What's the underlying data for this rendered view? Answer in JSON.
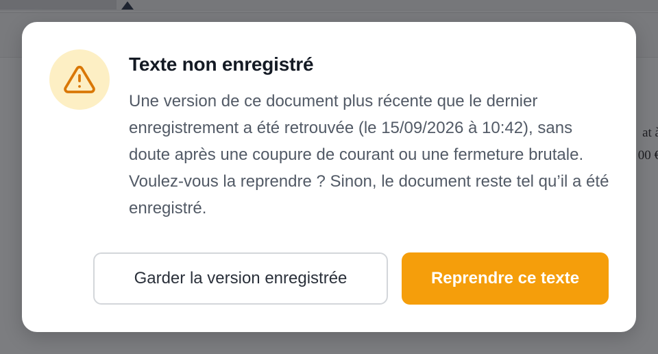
{
  "background": {
    "doc_fragment_line_1": "at à",
    "doc_fragment_line_2": "00 €"
  },
  "dialog": {
    "icon": "warning-triangle-icon",
    "title": "Texte non enregistré",
    "message": "Une version de ce document plus récente que le dernier enregistrement a été retrouvée (le 15/09/2026 à 10:42), sans doute après une coupure de courant ou une fermeture brutale. Voulez-vous la reprendre ? Sinon, le document reste tel qu’il a été enregistré.",
    "secondary_button_label": "Garder la version enregistrée",
    "primary_button_label": "Reprendre ce texte"
  },
  "colors": {
    "accent": "#f59e0b",
    "icon_background": "#fdefc4",
    "icon_stroke": "#d97706",
    "title_text": "#141a24",
    "body_text": "#525a66"
  }
}
